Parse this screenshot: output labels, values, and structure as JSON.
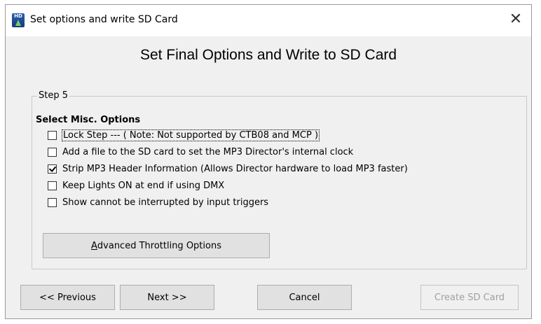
{
  "window": {
    "title": "Set options and write SD Card",
    "close_glyph": "✕",
    "app_icon": "hd-app-icon",
    "app_icon_text": "HD"
  },
  "heading": "Set Final Options and Write to SD Card",
  "group": {
    "legend": "Step 5",
    "subtitle": "Select Misc. Options",
    "options": [
      {
        "label": "Lock Step --- ( Note:  Not supported by CTB08 and MCP )",
        "checked": false
      },
      {
        "label": "Add a file to the SD card to set the MP3 Director's internal clock",
        "checked": false
      },
      {
        "label": "Strip MP3 Header Information (Allows Director hardware to load MP3 faster)",
        "checked": true
      },
      {
        "label": "Keep Lights ON at end if using DMX",
        "checked": false
      },
      {
        "label": "Show cannot be interrupted by input triggers",
        "checked": false
      }
    ],
    "advanced_button": {
      "accel": "A",
      "rest": "dvanced Throttling Options"
    }
  },
  "buttons": {
    "previous": "<< Previous",
    "next": "Next >>",
    "cancel": "Cancel",
    "create": "Create SD Card"
  }
}
